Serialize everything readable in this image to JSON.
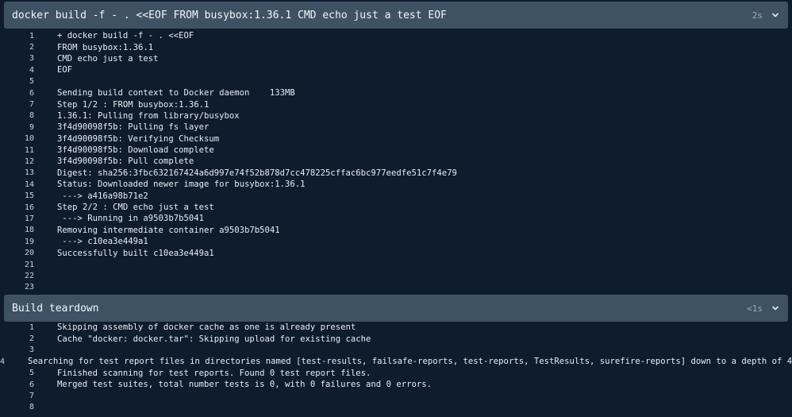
{
  "build_step": {
    "title": "docker build -f - . <<EOF FROM busybox:1.36.1 CMD echo just a test EOF",
    "duration": "2s",
    "chevron_icon": "chevron-down-icon",
    "lines": [
      {
        "n": "1",
        "text": "+ docker build -f - . <<EOF"
      },
      {
        "n": "2",
        "text": "FROM busybox:1.36.1"
      },
      {
        "n": "3",
        "text": "CMD echo just a test"
      },
      {
        "n": "4",
        "text": "EOF"
      },
      {
        "n": "5",
        "text": ""
      },
      {
        "n": "6",
        "text": "Sending build context to Docker daemon    133MB"
      },
      {
        "n": "7",
        "text": "Step 1/2 : FROM busybox:1.36.1"
      },
      {
        "n": "8",
        "text": "1.36.1: Pulling from library/busybox"
      },
      {
        "n": "9",
        "text": "3f4d90098f5b: Pulling fs layer"
      },
      {
        "n": "10",
        "text": "3f4d90098f5b: Verifying Checksum"
      },
      {
        "n": "11",
        "text": "3f4d90098f5b: Download complete"
      },
      {
        "n": "12",
        "text": "3f4d90098f5b: Pull complete"
      },
      {
        "n": "13",
        "text": "Digest: sha256:3fbc632167424a6d997e74f52b878d7cc478225cffac6bc977eedfe51c7f4e79"
      },
      {
        "n": "14",
        "text": "Status: Downloaded newer image for busybox:1.36.1"
      },
      {
        "n": "15",
        "text": " ---> a416a98b71e2"
      },
      {
        "n": "16",
        "text": "Step 2/2 : CMD echo just a test"
      },
      {
        "n": "17",
        "text": " ---> Running in a9503b7b5041"
      },
      {
        "n": "18",
        "text": "Removing intermediate container a9503b7b5041"
      },
      {
        "n": "19",
        "text": " ---> c10ea3e449a1"
      },
      {
        "n": "20",
        "text": "Successfully built c10ea3e449a1"
      },
      {
        "n": "21",
        "text": ""
      },
      {
        "n": "22",
        "text": ""
      },
      {
        "n": "23",
        "text": ""
      }
    ]
  },
  "teardown_step": {
    "title": "Build teardown",
    "duration": "<1s",
    "chevron_icon": "chevron-down-icon",
    "lines": [
      {
        "n": "1",
        "text": "Skipping assembly of docker cache as one is already present"
      },
      {
        "n": "2",
        "text": "Cache \"docker: docker.tar\": Skipping upload for existing cache"
      },
      {
        "n": "3",
        "text": ""
      },
      {
        "n": "4",
        "text": "Searching for test report files in directories named [test-results, failsafe-reports, test-reports, TestResults, surefire-reports] down to a depth of 4"
      },
      {
        "n": "5",
        "text": "Finished scanning for test reports. Found 0 test report files."
      },
      {
        "n": "6",
        "text": "Merged test suites, total number tests is 0, with 0 failures and 0 errors."
      },
      {
        "n": "7",
        "text": ""
      },
      {
        "n": "8",
        "text": ""
      }
    ]
  },
  "colors": {
    "background": "#0f1c2e",
    "header_background": "#3f5264",
    "text": "#e6edf5",
    "muted": "#9aa9b8"
  }
}
